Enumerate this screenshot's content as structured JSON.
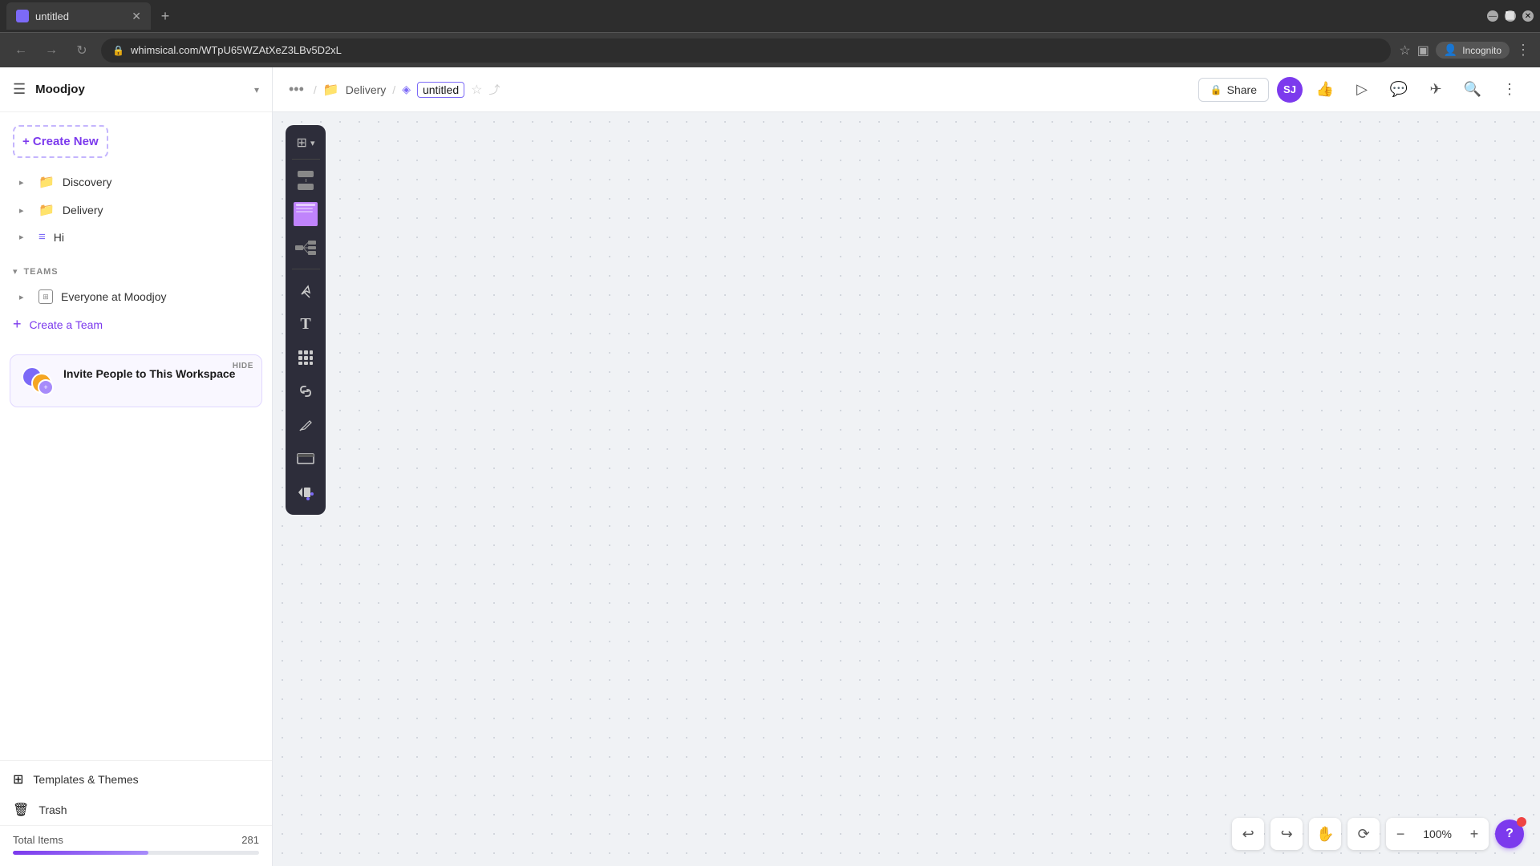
{
  "browser": {
    "tab_title": "untitled",
    "url": "whimsical.com/WTpU65WZAtXeZ3LBv5D2xL",
    "new_tab_icon": "+",
    "incognito_label": "Incognito"
  },
  "sidebar": {
    "workspace_name": "Moodjoy",
    "create_new_label": "+ Create New",
    "nav_items": [
      {
        "label": "Discovery",
        "type": "folder"
      },
      {
        "label": "Delivery",
        "type": "folder"
      },
      {
        "label": "Hi",
        "type": "doc"
      }
    ],
    "teams_section_label": "TEAMS",
    "team_items": [
      {
        "label": "Everyone at Moodjoy"
      }
    ],
    "create_team_label": "Create a Team",
    "invite_title": "Invite People to This Workspace",
    "invite_hide": "HIDE",
    "templates_label": "Templates & Themes",
    "trash_label": "Trash",
    "total_label": "Total Items",
    "total_count": "281",
    "progress_percent": 55
  },
  "topbar": {
    "delivery_label": "Delivery",
    "current_page": "untitled",
    "share_label": "Share",
    "user_initials": "SJ"
  },
  "toolbar": {
    "tools": [
      {
        "name": "flowchart-tool",
        "type": "flowchart"
      },
      {
        "name": "sticky-tool",
        "type": "sticky"
      },
      {
        "name": "mindmap-tool",
        "type": "mindmap"
      },
      {
        "name": "divider",
        "type": "divider"
      },
      {
        "name": "arrow-tool",
        "icon": "↪"
      },
      {
        "name": "text-tool",
        "icon": "T"
      },
      {
        "name": "grid-tool",
        "icon": "⠿"
      },
      {
        "name": "link-tool",
        "icon": "⊙"
      },
      {
        "name": "pen-tool",
        "icon": "✏"
      },
      {
        "name": "frame-tool",
        "icon": "▭"
      },
      {
        "name": "component-tool",
        "icon": "▶⬛"
      }
    ]
  },
  "canvas": {
    "zoom_level": "100%"
  },
  "icons": {
    "menu": "☰",
    "chevron_down": "▾",
    "chevron_right": "▸",
    "folder": "📁",
    "doc": "📄",
    "star": "☆",
    "lock": "🔒",
    "search": "🔍",
    "like": "👍",
    "present": "▶",
    "comment": "💬",
    "send": "✈",
    "more": "⋯",
    "templates": "⊞",
    "trash": "🗑",
    "undo": "↩",
    "redo": "↪",
    "hand": "✋",
    "history": "⟳",
    "zoom_in": "+",
    "zoom_out": "−",
    "help": "?"
  }
}
